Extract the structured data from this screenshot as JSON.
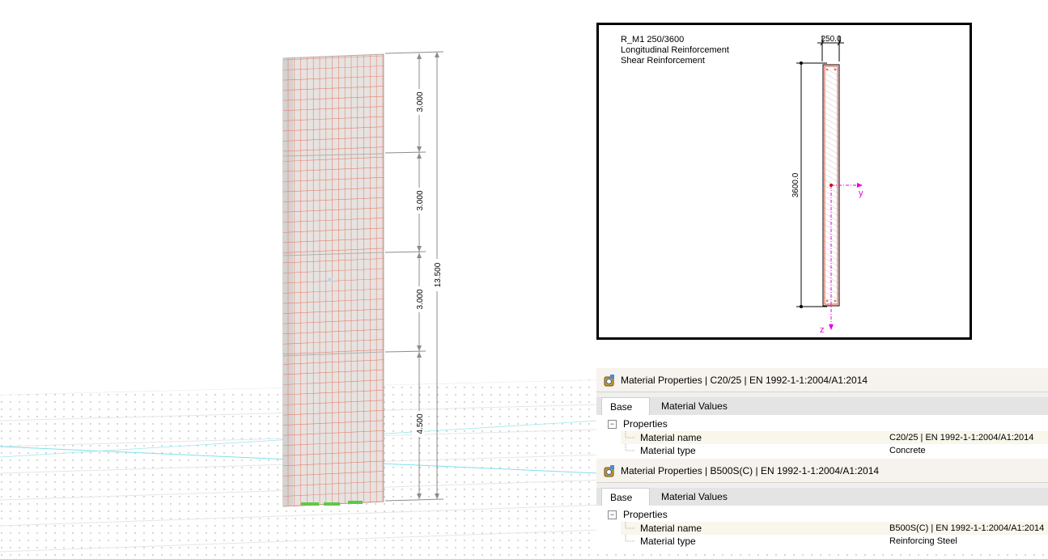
{
  "model": {
    "dimensions": {
      "segments": [
        "3.000",
        "3.000",
        "3.000",
        "4.500"
      ],
      "total": "13.500"
    }
  },
  "section": {
    "title": "R_M1 250/3600",
    "line2": "Longitudinal Reinforcement",
    "line3": "Shear Reinforcement",
    "width_label": "250.0",
    "height_label": "3600.0",
    "axis_y": "y",
    "axis_z": "z"
  },
  "panels": [
    {
      "title": "Material Properties | C20/25 | EN 1992-1-1:2004/A1:2014",
      "tabs": [
        "Base",
        "Material Values"
      ],
      "group": "Properties",
      "rows": [
        {
          "key": "Material name",
          "value": "C20/25 | EN 1992-1-1:2004/A1:2014"
        },
        {
          "key": "Material type",
          "value": "Concrete"
        }
      ]
    },
    {
      "title": "Material Properties | B500S(C) | EN 1992-1-1:2004/A1:2014",
      "tabs": [
        "Base",
        "Material Values"
      ],
      "group": "Properties",
      "rows": [
        {
          "key": "Material name",
          "value": "B500S(C) | EN 1992-1-1:2004/A1:2014"
        },
        {
          "key": "Material type",
          "value": "Reinforcing Steel"
        }
      ]
    }
  ],
  "colors": {
    "rebar": "#e5735f",
    "wall": "#e6e3e1",
    "dimension": "#8c8c8c",
    "axis": "#e600e6",
    "support": "#5fc845"
  }
}
